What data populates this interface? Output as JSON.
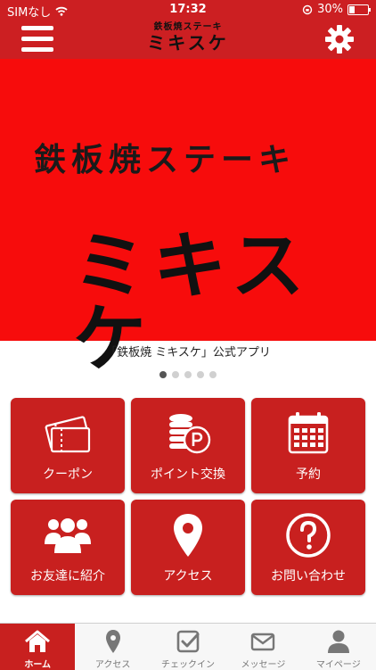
{
  "status_bar": {
    "carrier": "SIMなし",
    "time": "17:32",
    "battery": "30%",
    "battery_level": 0.3
  },
  "header": {
    "logo_sub": "鉄板焼ステーキ",
    "logo_main": "ミキスケ"
  },
  "banner": {
    "sub": "鉄板焼ステーキ",
    "main": "ミキスケ"
  },
  "carousel": {
    "caption": "「鉄板焼 ミキスケ」公式アプリ",
    "dot_count": 5,
    "active_index": 0
  },
  "tiles": [
    {
      "label": "クーポン",
      "icon": "ticket-icon"
    },
    {
      "label": "ポイント交換",
      "icon": "coins-icon"
    },
    {
      "label": "予約",
      "icon": "calendar-icon"
    },
    {
      "label": "お友達に紹介",
      "icon": "group-icon"
    },
    {
      "label": "アクセス",
      "icon": "map-pin-icon"
    },
    {
      "label": "お問い合わせ",
      "icon": "question-icon"
    }
  ],
  "tabbar": [
    {
      "label": "ホーム",
      "icon": "home-icon",
      "active": true
    },
    {
      "label": "アクセス",
      "icon": "map-pin-icon",
      "active": false
    },
    {
      "label": "チェックイン",
      "icon": "checkin-icon",
      "active": false
    },
    {
      "label": "メッセージ",
      "icon": "mail-icon",
      "active": false
    },
    {
      "label": "マイページ",
      "icon": "user-icon",
      "active": false
    }
  ],
  "colors": {
    "brand_red": "#cc1f22",
    "banner_red": "#f70c0c",
    "tile_red": "#c8201f"
  }
}
